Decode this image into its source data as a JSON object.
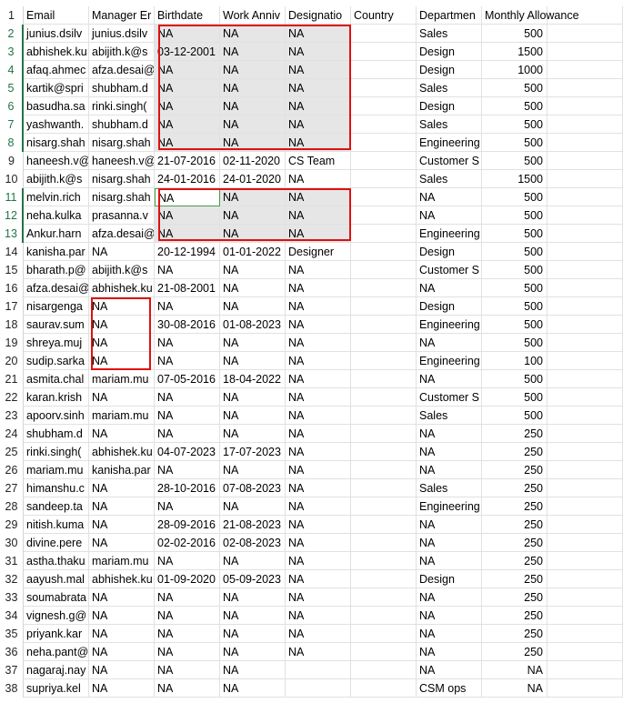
{
  "header": [
    "Email",
    "Manager Er",
    "Birthdate",
    "Work Anniv",
    "Designatio",
    "Country",
    "Departmen",
    "Monthly Allowance",
    ""
  ],
  "rows": [
    {
      "num": "2",
      "cells": [
        "junius.dsilv",
        "junius.dsilv",
        "NA",
        "NA",
        "NA",
        "",
        "Sales",
        "500",
        ""
      ]
    },
    {
      "num": "3",
      "cells": [
        "abhishek.ku",
        "abijith.k@s",
        "03-12-2001",
        "NA",
        "NA",
        "",
        "Design",
        "1500",
        ""
      ]
    },
    {
      "num": "4",
      "cells": [
        "afaq.ahmec",
        "afza.desai@",
        "NA",
        "NA",
        "NA",
        "",
        "Design",
        "1000",
        ""
      ]
    },
    {
      "num": "5",
      "cells": [
        "kartik@spri",
        "shubham.d",
        "NA",
        "NA",
        "NA",
        "",
        "Sales",
        "500",
        ""
      ]
    },
    {
      "num": "6",
      "cells": [
        "basudha.sa",
        "rinki.singh(",
        "NA",
        "NA",
        "NA",
        "",
        "Design",
        "500",
        ""
      ]
    },
    {
      "num": "7",
      "cells": [
        "yashwanth.",
        "shubham.d",
        "NA",
        "NA",
        "NA",
        "",
        "Sales",
        "500",
        ""
      ]
    },
    {
      "num": "8",
      "cells": [
        "nisarg.shah",
        "nisarg.shah",
        "NA",
        "NA",
        "NA",
        "",
        "Engineering",
        "500",
        ""
      ]
    },
    {
      "num": "9",
      "cells": [
        "haneesh.v@",
        "haneesh.v@",
        "21-07-2016",
        "02-11-2020",
        "CS Team",
        "",
        "Customer S",
        "500",
        ""
      ]
    },
    {
      "num": "10",
      "cells": [
        "abijith.k@s",
        "nisarg.shah",
        "24-01-2016",
        "24-01-2020",
        "NA",
        "",
        "Sales",
        "1500",
        ""
      ]
    },
    {
      "num": "11",
      "cells": [
        "melvin.rich",
        "nisarg.shah",
        "NA",
        "NA",
        "NA",
        "",
        "NA",
        "500",
        ""
      ]
    },
    {
      "num": "12",
      "cells": [
        "neha.kulka",
        "prasanna.v",
        "NA",
        "NA",
        "NA",
        "",
        "NA",
        "500",
        ""
      ]
    },
    {
      "num": "13",
      "cells": [
        "Ankur.harn",
        "afza.desai@",
        "NA",
        "NA",
        "NA",
        "",
        "Engineering",
        "500",
        ""
      ]
    },
    {
      "num": "14",
      "cells": [
        "kanisha.par",
        "NA",
        "20-12-1994",
        "01-01-2022",
        "Designer",
        "",
        "Design",
        "500",
        ""
      ]
    },
    {
      "num": "15",
      "cells": [
        "bharath.p@",
        "abijith.k@s",
        "NA",
        "NA",
        "NA",
        "",
        "Customer S",
        "500",
        ""
      ]
    },
    {
      "num": "16",
      "cells": [
        "afza.desai@",
        "abhishek.ku",
        "21-08-2001",
        "NA",
        "NA",
        "",
        "NA",
        "500",
        ""
      ]
    },
    {
      "num": "17",
      "cells": [
        "nisargenga",
        "NA",
        "NA",
        "NA",
        "NA",
        "",
        "Design",
        "500",
        ""
      ]
    },
    {
      "num": "18",
      "cells": [
        "saurav.sum",
        "NA",
        "30-08-2016",
        "01-08-2023",
        "NA",
        "",
        "Engineering",
        "500",
        ""
      ]
    },
    {
      "num": "19",
      "cells": [
        "shreya.muj",
        "NA",
        "NA",
        "NA",
        "NA",
        "",
        "NA",
        "500",
        ""
      ]
    },
    {
      "num": "20",
      "cells": [
        "sudip.sarka",
        "NA",
        "NA",
        "NA",
        "NA",
        "",
        "Engineering",
        "100",
        ""
      ]
    },
    {
      "num": "21",
      "cells": [
        "asmita.chal",
        "mariam.mu",
        "07-05-2016",
        "18-04-2022",
        "NA",
        "",
        "NA",
        "500",
        ""
      ]
    },
    {
      "num": "22",
      "cells": [
        "karan.krish",
        "NA",
        "NA",
        "NA",
        "NA",
        "",
        "Customer S",
        "500",
        ""
      ]
    },
    {
      "num": "23",
      "cells": [
        "apoorv.sinh",
        "mariam.mu",
        "NA",
        "NA",
        "NA",
        "",
        "Sales",
        "500",
        ""
      ]
    },
    {
      "num": "24",
      "cells": [
        "shubham.d",
        "NA",
        "NA",
        "NA",
        "NA",
        "",
        "NA",
        "250",
        ""
      ]
    },
    {
      "num": "25",
      "cells": [
        "rinki.singh(",
        "abhishek.ku",
        "04-07-2023",
        "17-07-2023",
        "NA",
        "",
        "NA",
        "250",
        ""
      ]
    },
    {
      "num": "26",
      "cells": [
        "mariam.mu",
        "kanisha.par",
        "NA",
        "NA",
        "NA",
        "",
        "NA",
        "250",
        ""
      ]
    },
    {
      "num": "27",
      "cells": [
        "himanshu.c",
        "NA",
        "28-10-2016",
        "07-08-2023",
        "NA",
        "",
        "Sales",
        "250",
        ""
      ]
    },
    {
      "num": "28",
      "cells": [
        "sandeep.ta",
        "NA",
        "NA",
        "NA",
        "NA",
        "",
        "Engineering",
        "250",
        ""
      ]
    },
    {
      "num": "29",
      "cells": [
        "nitish.kuma",
        "NA",
        "28-09-2016",
        "21-08-2023",
        "NA",
        "",
        "NA",
        "250",
        ""
      ]
    },
    {
      "num": "30",
      "cells": [
        "divine.pere",
        "NA",
        "02-02-2016",
        "02-08-2023",
        "NA",
        "",
        "NA",
        "250",
        ""
      ]
    },
    {
      "num": "31",
      "cells": [
        "astha.thaku",
        "mariam.mu",
        "NA",
        "NA",
        "NA",
        "",
        "NA",
        "250",
        ""
      ]
    },
    {
      "num": "32",
      "cells": [
        "aayush.mal",
        "abhishek.ku",
        "01-09-2020",
        "05-09-2023",
        "NA",
        "",
        "Design",
        "250",
        ""
      ]
    },
    {
      "num": "33",
      "cells": [
        "soumabrata",
        "NA",
        "NA",
        "NA",
        "NA",
        "",
        "NA",
        "250",
        ""
      ]
    },
    {
      "num": "34",
      "cells": [
        "vignesh.g@",
        "NA",
        "NA",
        "NA",
        "NA",
        "",
        "NA",
        "250",
        ""
      ]
    },
    {
      "num": "35",
      "cells": [
        "priyank.kar",
        "NA",
        "NA",
        "NA",
        "NA",
        "",
        "NA",
        "250",
        ""
      ]
    },
    {
      "num": "36",
      "cells": [
        "neha.pant@",
        "NA",
        "NA",
        "NA",
        "NA",
        "",
        "NA",
        "250",
        ""
      ]
    },
    {
      "num": "37",
      "cells": [
        "nagaraj.nay",
        "NA",
        "NA",
        "NA",
        "",
        "",
        "NA",
        "NA",
        ""
      ]
    },
    {
      "num": "38",
      "cells": [
        "supriya.kel",
        "NA",
        "NA",
        "NA",
        "",
        "",
        "CSM ops",
        "NA",
        ""
      ]
    }
  ],
  "colors": {
    "highlight": "#e01010",
    "selection": "#e6e6e6",
    "active_border": "#4a9a4a",
    "row_selected": "#217346"
  }
}
